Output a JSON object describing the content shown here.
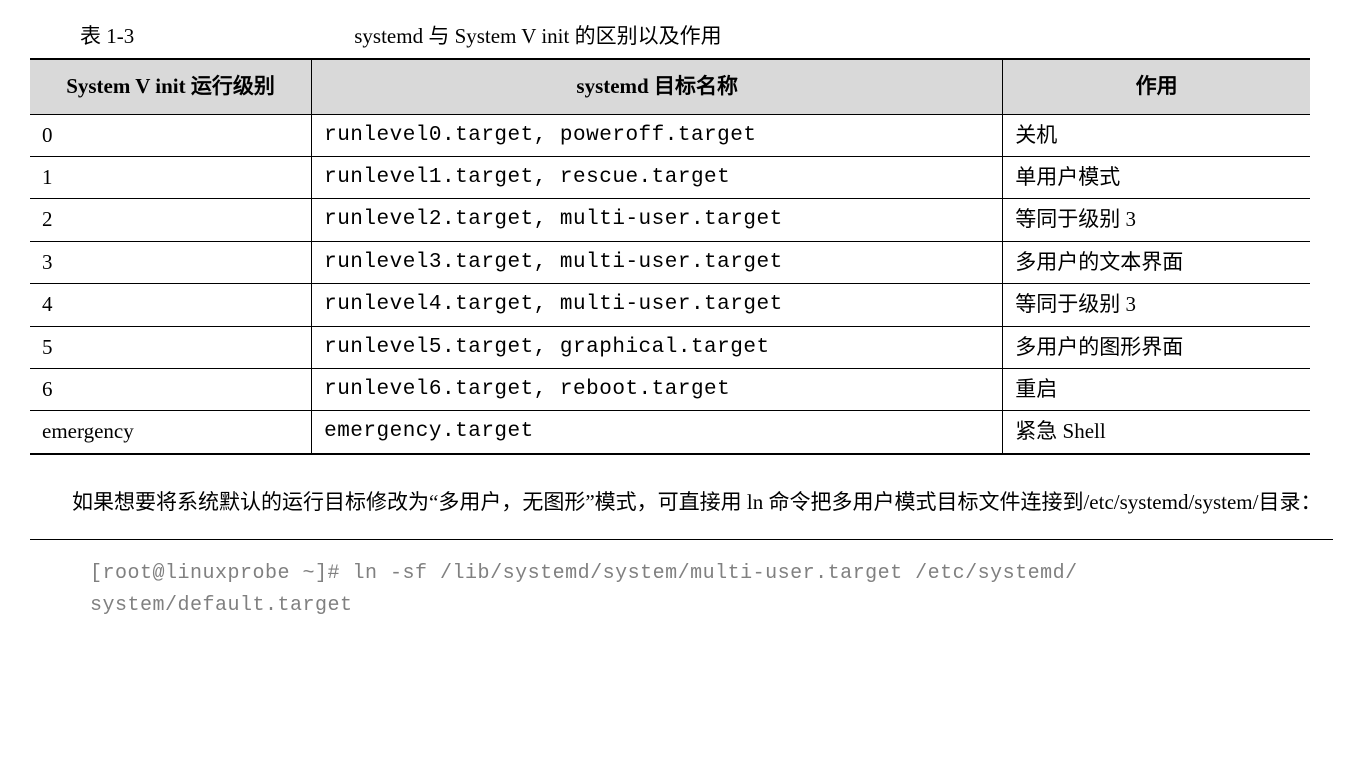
{
  "caption": {
    "table_num": "表 1-3",
    "title": "systemd 与 System V init 的区别以及作用"
  },
  "headers": {
    "col1": "System V init 运行级别",
    "col2": "systemd 目标名称",
    "col3": "作用"
  },
  "rows": [
    {
      "level": "0",
      "target": "runlevel0.target, poweroff.target",
      "desc": "关机"
    },
    {
      "level": "1",
      "target": "runlevel1.target, rescue.target",
      "desc": "单用户模式"
    },
    {
      "level": "2",
      "target": "runlevel2.target, multi-user.target",
      "desc": "等同于级别 3"
    },
    {
      "level": "3",
      "target": "runlevel3.target, multi-user.target",
      "desc": "多用户的文本界面"
    },
    {
      "level": "4",
      "target": "runlevel4.target, multi-user.target",
      "desc": "等同于级别 3"
    },
    {
      "level": "5",
      "target": "runlevel5.target, graphical.target",
      "desc": "多用户的图形界面"
    },
    {
      "level": "6",
      "target": "runlevel6.target, reboot.target",
      "desc": "重启"
    },
    {
      "level": "emergency",
      "target": "emergency.target",
      "desc": "紧急 Shell"
    }
  ],
  "body_text": "如果想要将系统默认的运行目标修改为“多用户，无图形”模式，可直接用 ln 命令把多用户模式目标文件连接到/etc/systemd/system/目录：",
  "code": {
    "line1": "[root@linuxprobe ~]# ln -sf /lib/systemd/system/multi-user.target /etc/systemd/",
    "line2": "system/default.target"
  }
}
